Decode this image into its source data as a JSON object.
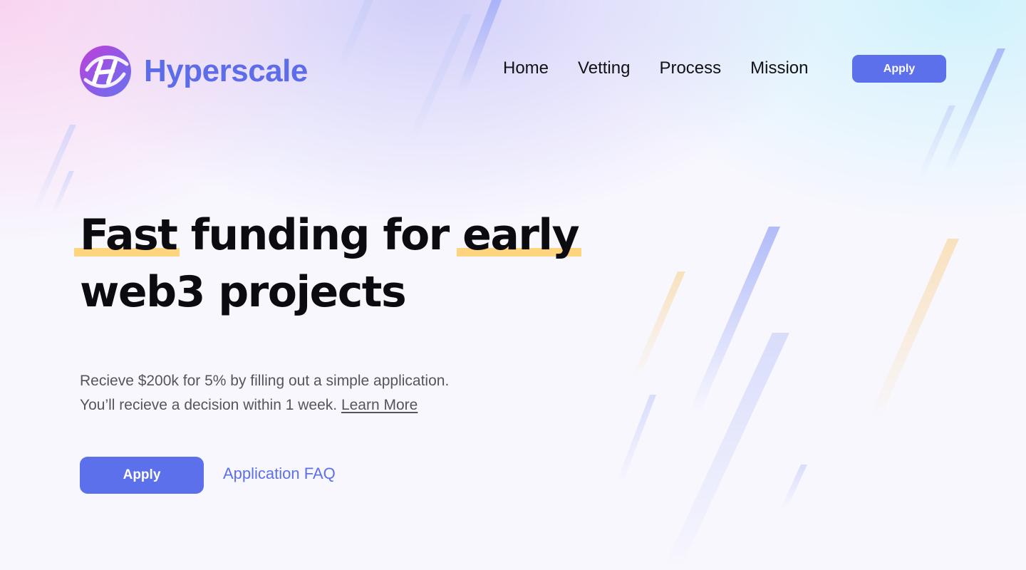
{
  "brand": {
    "name": "Hyperscale",
    "logo_icon": "hyperscale-logo-icon",
    "color": "#5d6de9"
  },
  "nav": {
    "items": [
      {
        "label": "Home"
      },
      {
        "label": "Vetting"
      },
      {
        "label": "Process"
      },
      {
        "label": "Mission"
      }
    ],
    "apply_label": "Apply"
  },
  "hero": {
    "headline_parts": [
      "Fast",
      "funding for",
      "early",
      "web3 projects"
    ],
    "highlighted_words": [
      "Fast",
      "early"
    ],
    "subtext_line1": "Recieve $200k for 5% by filling out a simple application.",
    "subtext_line2": "You’ll recieve a decision within 1 week.",
    "learn_more_label": "Learn More",
    "apply_label": "Apply",
    "faq_label": "Application FAQ"
  },
  "colors": {
    "accent": "#5c70ec",
    "highlight": "#ffd47e",
    "heading": "#0b0b10",
    "body_text": "#55555f"
  }
}
